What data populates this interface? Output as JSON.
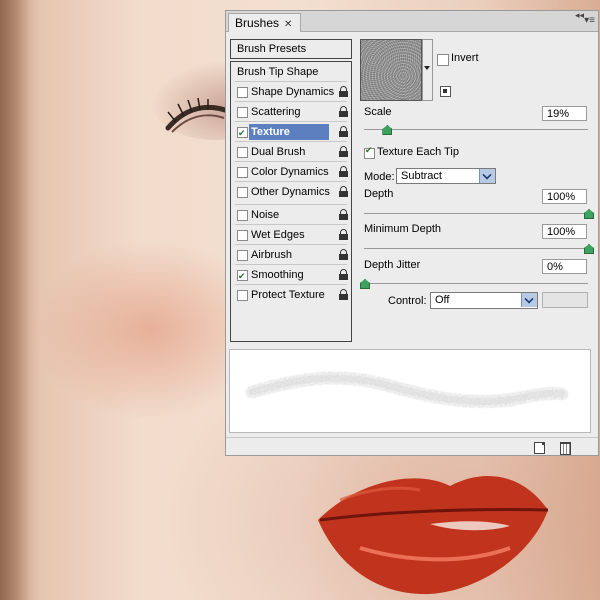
{
  "panel": {
    "tab_label": "Brushes",
    "tab_close": "✕",
    "collapse_glyph": "◂◂",
    "menu_glyph": "▾≡"
  },
  "left_list": {
    "presets": "Brush Presets",
    "header": "Brush Tip Shape",
    "items": [
      {
        "label": "Shape Dynamics",
        "checked": false,
        "locked": true
      },
      {
        "label": "Scattering",
        "checked": false,
        "locked": true
      },
      {
        "label": "Texture",
        "checked": true,
        "locked": true,
        "selected": true
      },
      {
        "label": "Dual Brush",
        "checked": false,
        "locked": true
      },
      {
        "label": "Color Dynamics",
        "checked": false,
        "locked": true
      },
      {
        "label": "Other Dynamics",
        "checked": false,
        "locked": true
      },
      {
        "label": "Noise",
        "checked": false,
        "locked": true
      },
      {
        "label": "Wet Edges",
        "checked": false,
        "locked": true
      },
      {
        "label": "Airbrush",
        "checked": false,
        "locked": true
      },
      {
        "label": "Smoothing",
        "checked": true,
        "locked": true
      },
      {
        "label": "Protect Texture",
        "checked": false,
        "locked": true
      }
    ]
  },
  "texture": {
    "invert_label": "Invert",
    "invert_checked": false,
    "scale_label": "Scale",
    "scale_value": "19%",
    "scale_fraction": 0.1,
    "texture_each_tip_label": "Texture Each Tip",
    "texture_each_tip_checked": true,
    "mode_label": "Mode:",
    "mode_value": "Subtract",
    "depth_label": "Depth",
    "depth_value": "100%",
    "depth_fraction": 1.0,
    "min_depth_label": "Minimum Depth",
    "min_depth_value": "100%",
    "min_depth_fraction": 1.0,
    "depth_jitter_label": "Depth Jitter",
    "depth_jitter_value": "0%",
    "depth_jitter_fraction": 0.0,
    "control_label": "Control:",
    "control_value": "Off"
  },
  "colors": {
    "selected_item": "#5b7fbf",
    "slider_knob": "#3fa160",
    "panel_bg": "#ececec"
  },
  "icons": {
    "lock": "lock-icon",
    "new_preset": "new-preset-icon",
    "new_brush": "new-brush-icon",
    "delete": "trash-icon"
  }
}
